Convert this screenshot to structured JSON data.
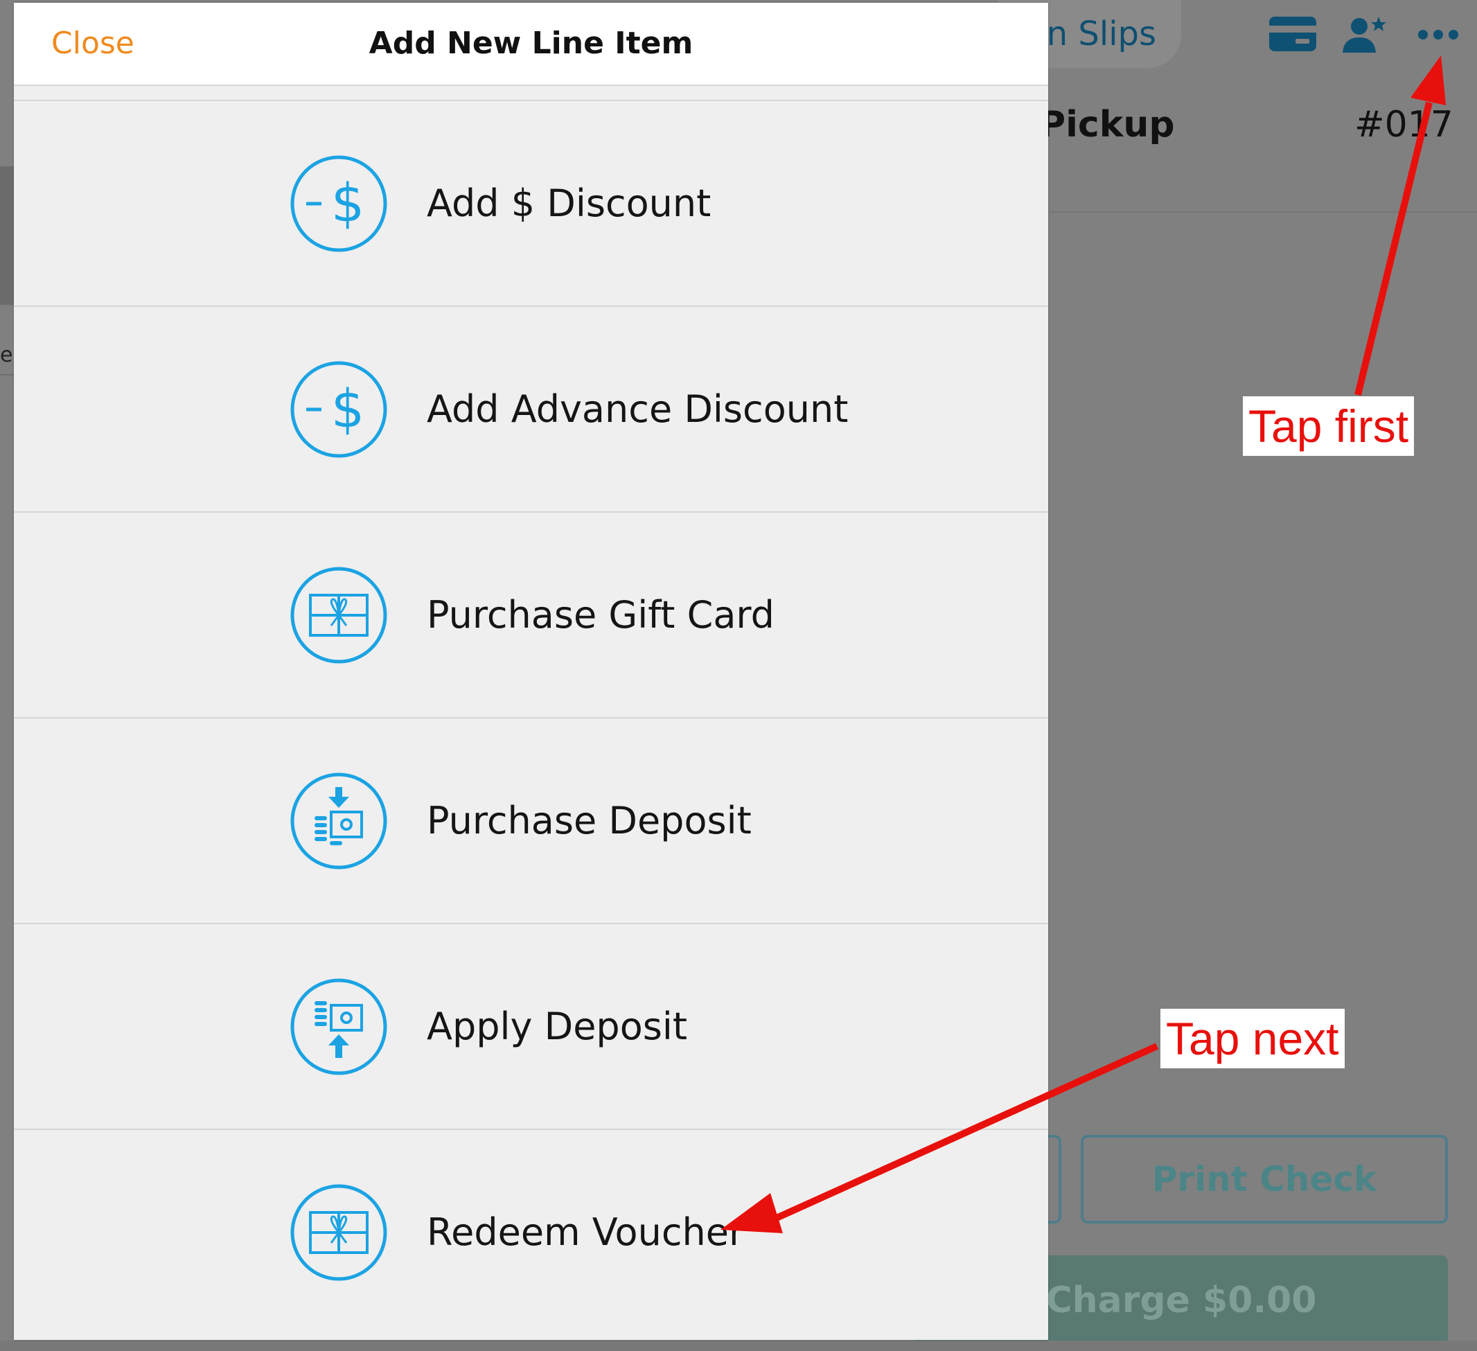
{
  "background": {
    "tab_order_slips": "n Slips",
    "order_type": "Pickup",
    "order_number": "#017",
    "left_text": "ee",
    "print_check": "Print Check",
    "charge": "Charge $0.00",
    "top_icons": [
      "credit-card-icon",
      "customer-icon",
      "more-icon"
    ]
  },
  "modal": {
    "close": "Close",
    "title": "Add New Line Item",
    "items": [
      {
        "label": "Add $ Discount",
        "icon": "dollar-discount-icon"
      },
      {
        "label": "Add Advance Discount",
        "icon": "dollar-discount-icon"
      },
      {
        "label": "Purchase Gift Card",
        "icon": "gift-card-icon"
      },
      {
        "label": "Purchase Deposit",
        "icon": "deposit-in-icon"
      },
      {
        "label": "Apply Deposit",
        "icon": "deposit-out-icon"
      },
      {
        "label": "Redeem Voucher",
        "icon": "gift-card-icon"
      }
    ]
  },
  "annotations": {
    "first": "Tap first",
    "next": "Tap next",
    "color": "#e8100c"
  },
  "colors": {
    "accent_blue": "#1ba3e3",
    "close_orange": "#f08a1e",
    "overlay_gray": "#808080"
  }
}
